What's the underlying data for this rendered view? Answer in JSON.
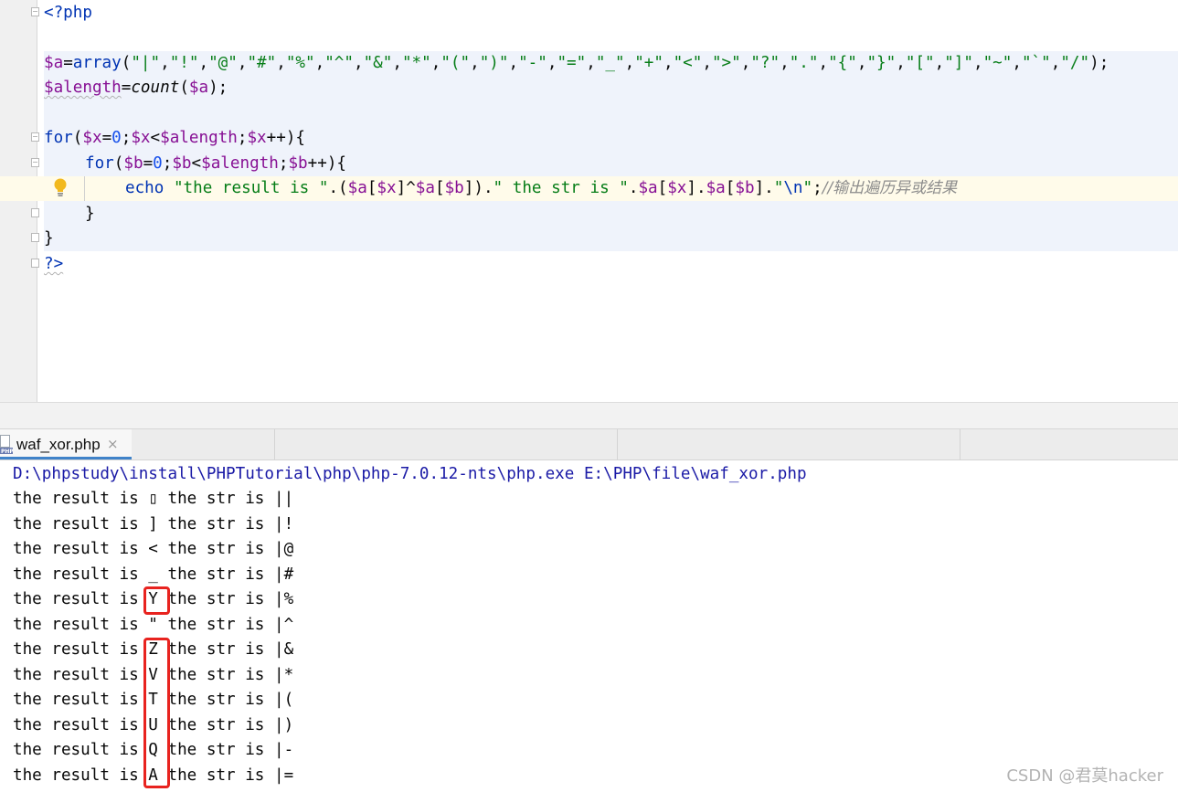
{
  "editor": {
    "lines": {
      "open_tag": "<?php",
      "a_var": "$a",
      "a_eq": "=",
      "a_func": "array",
      "a_open": "(",
      "a_strings": [
        "\"|\"",
        "\"!\"",
        "\"@\"",
        "\"#\"",
        "\"%\"",
        "\"^\"",
        "\"&\"",
        "\"*\"",
        "\"(\"",
        "\")\"",
        "\"-\"",
        "\"=\"",
        "\"_\"",
        "\"+\"",
        "\"<\"",
        "\">\"",
        "\"?\"",
        "\".\"",
        "\"{\"",
        "\"}\"",
        "\"[\"",
        "\"]\"",
        "\"~\"",
        "\"`\"",
        "\"/\""
      ],
      "a_close": ");",
      "len_var": "$alength",
      "len_eq": "=",
      "len_func": "count",
      "len_arg_open": "(",
      "len_arg": "$a",
      "len_close": ");",
      "for1_kw": "for",
      "for1_a": "(",
      "for1_v1": "$x",
      "for1_eq": "=",
      "for1_n": "0",
      "for1_s1": ";",
      "for1_v2": "$x",
      "for1_lt": "<",
      "for1_v3": "$alength",
      "for1_s2": ";",
      "for1_v4": "$x",
      "for1_end": "++){",
      "for2_kw": "for",
      "for2_a": "(",
      "for2_v1": "$b",
      "for2_eq": "=",
      "for2_n": "0",
      "for2_s1": ";",
      "for2_v2": "$b",
      "for2_lt": "<",
      "for2_v3": "$alength",
      "for2_s2": ";",
      "for2_v4": "$b",
      "for2_end": "++){",
      "echo_kw": "echo",
      "echo_s1": "\"the result is \"",
      "echo_p1": ".(",
      "echo_a1": "$a",
      "echo_b1": "[",
      "echo_x1": "$x",
      "echo_c1": "]^",
      "echo_a2": "$a",
      "echo_b2": "[",
      "echo_x2": "$b",
      "echo_c2": "]).",
      "echo_s2": "\" the str is \"",
      "echo_d1": ".",
      "echo_a3": "$a",
      "echo_b3": "[",
      "echo_x3": "$x",
      "echo_c3": "].",
      "echo_a4": "$a",
      "echo_b4": "[",
      "echo_x4": "$b",
      "echo_c4": "].",
      "echo_s3a": "\"",
      "echo_s3b": "\\n",
      "echo_s3c": "\"",
      "echo_semi": ";",
      "echo_comment": "//输出遍历异或结果",
      "brace_inner": "}",
      "brace_outer": "}",
      "close_tag": "?>"
    }
  },
  "run_panel": {
    "tab_label": "waf_xor.php",
    "tab_close": "×",
    "tab_icon": "php-file-icon",
    "command": "D:\\phpstudy\\install\\PHPTutorial\\php\\php-7.0.12-nts\\php.exe E:\\PHP\\file\\waf_xor.php",
    "output": [
      "the result is ▯ the str is ||",
      "the result is ] the str is |!",
      "the result is < the str is |@",
      "the result is _ the str is |#",
      "the result is Y the str is |%",
      "the result is \" the str is |^",
      "the result is Z the str is |&",
      "the result is V the str is |*",
      "the result is T the str is |(",
      "the result is U the str is |)",
      "the result is Q the str is |-",
      "the result is A the str is |="
    ]
  },
  "watermark": "CSDN @君莫hacker",
  "colors": {
    "keyword": "#0033b3",
    "variable": "#871094",
    "string": "#067d17",
    "number": "#1750eb",
    "comment": "#8c8c8c",
    "highlight_box": "#e8231f"
  }
}
